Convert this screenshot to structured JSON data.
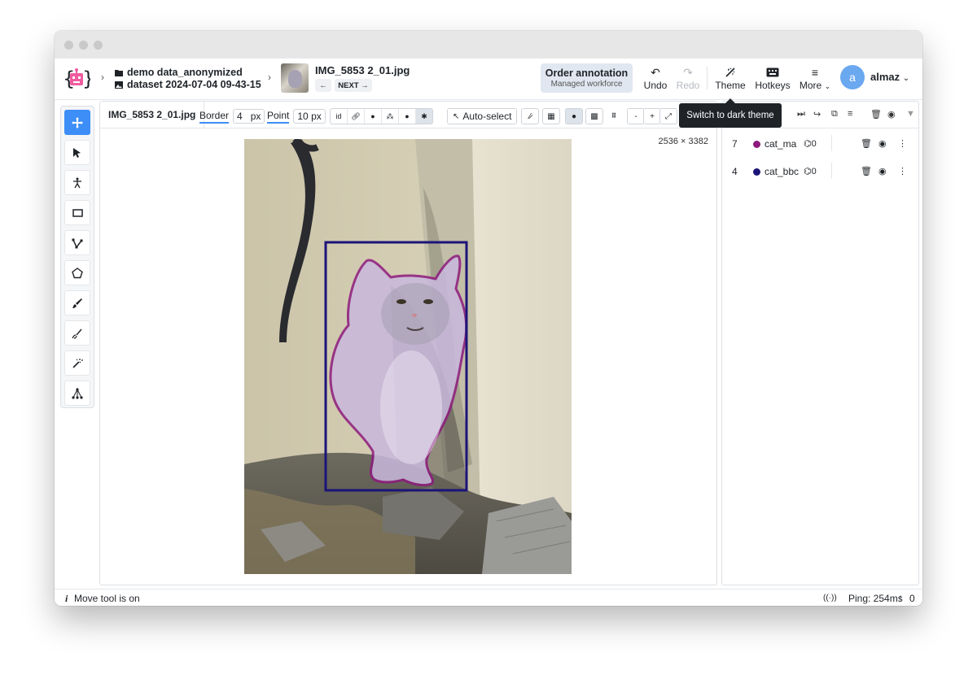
{
  "breadcrumb": {
    "project": "demo data_anonymized",
    "dataset": "dataset 2024-07-04 09-43-15"
  },
  "file": {
    "name": "IMG_5853 2_01.jpg",
    "prev_label": "←",
    "next_label": "NEXT →"
  },
  "order_button": {
    "title": "Order annotation",
    "subtitle": "Managed workforce"
  },
  "header_actions": {
    "undo": "Undo",
    "redo": "Redo",
    "theme": "Theme",
    "hotkeys": "Hotkeys",
    "more": "More"
  },
  "user": {
    "initial": "a",
    "name": "almaz"
  },
  "tooltip": "Switch to dark theme",
  "canvas_toolbar": {
    "tab_name": "IMG_5853 2_01.jpg",
    "border_label": "Border",
    "border_value": "4",
    "border_unit": "px",
    "point_label": "Point",
    "point_value": "10",
    "point_unit": "px",
    "autoselect_label": "Auto-select",
    "zoom_out": "-",
    "zoom_in": "+"
  },
  "image_dims": "2536 × 3382",
  "objects": [
    {
      "id": "7",
      "name": "cat_ma",
      "tags": "0",
      "color": "#8e1a7e"
    },
    {
      "id": "4",
      "name": "cat_bbc",
      "tags": "0",
      "color": "#1c1478"
    }
  ],
  "status": {
    "info_icon": "i",
    "message": "Move tool is on",
    "ping": "Ping: 254ms",
    "upload_count": "0"
  },
  "colors": {
    "accent": "#3d8ef7",
    "mask": "#8e1a7e",
    "bbox": "#1c1478",
    "avatar": "#6aa8f0"
  }
}
